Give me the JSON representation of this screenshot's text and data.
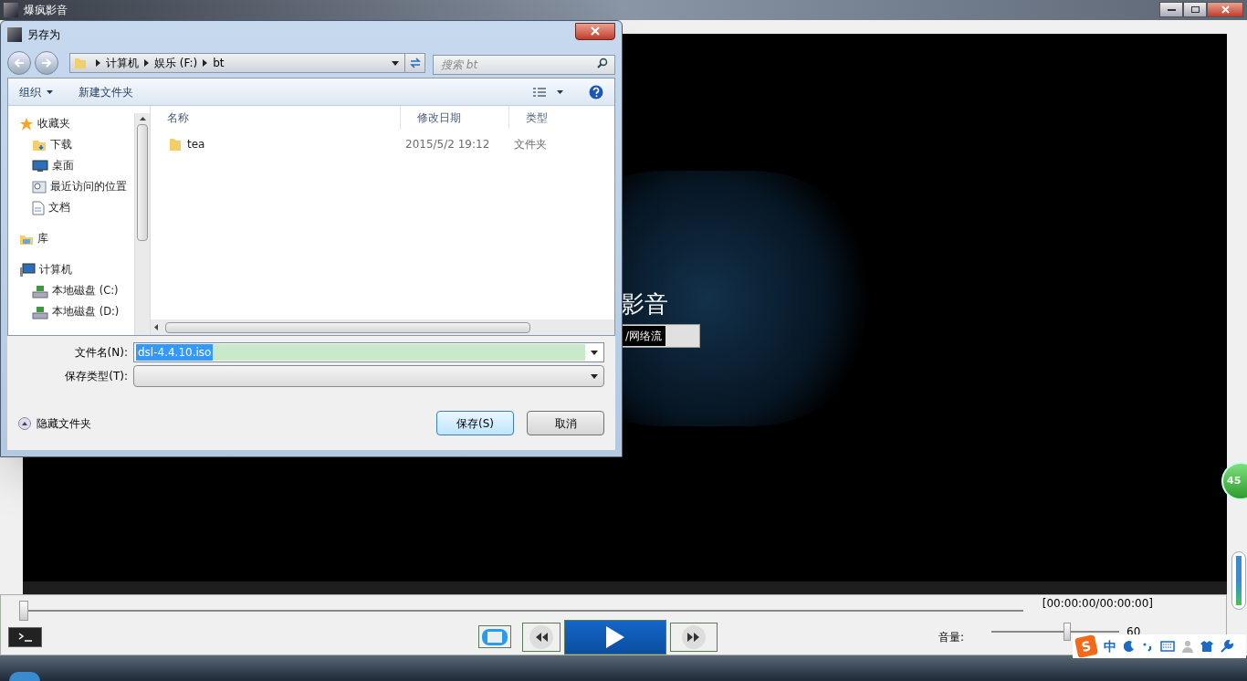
{
  "player": {
    "title": "爆疯影音",
    "logo_text": "影音",
    "open_button": "/网络流",
    "progress": {
      "level": 0
    },
    "time": "[00:00:00/00:00:00]",
    "volume_label": "音量:",
    "volume": {
      "level": 0.6
    },
    "volume_reading": "60",
    "ime_logo": "S",
    "ime_mode": "中",
    "badge": "45"
  },
  "dialog": {
    "title": "另存为",
    "breadcrumb": [
      "计算机",
      "娱乐 (F:)",
      "bt"
    ],
    "search": {
      "placeholder": "搜索 bt"
    },
    "toolbar": [
      "组织",
      "新建文件夹"
    ],
    "sidebar": [
      {
        "label": "收藏夹",
        "kind": "favorites",
        "children": [
          {
            "label": "下载",
            "kind": "download"
          },
          {
            "label": "桌面",
            "kind": "desktop"
          },
          {
            "label": "最近访问的位置",
            "kind": "recent"
          },
          {
            "label": "文档",
            "kind": "document"
          }
        ]
      },
      {
        "label": "库",
        "kind": "library"
      },
      {
        "label": "计算机",
        "kind": "computer",
        "children": [
          {
            "label": "本地磁盘 (C:)",
            "kind": "disk"
          },
          {
            "label": "本地磁盘 (D:)",
            "kind": "disk"
          }
        ]
      }
    ],
    "columns": [
      "名称",
      "修改日期",
      "类型"
    ],
    "rows": [
      {
        "name": "tea",
        "date": "2015/5/2 19:12",
        "type": "文件夹"
      }
    ],
    "filename_label": "文件名(N):",
    "filename": "dsl-4.4.10.iso",
    "filetype_label": "保存类型(T):",
    "hide_folders": "隐藏文件夹",
    "buttons": [
      "保存(S)",
      "取消"
    ]
  }
}
